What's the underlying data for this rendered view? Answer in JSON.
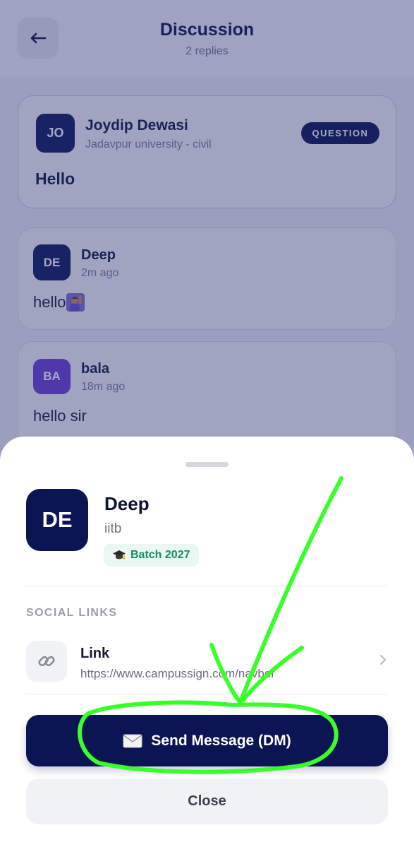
{
  "header": {
    "title": "Discussion",
    "subtitle": "2 replies",
    "back_icon": "arrow-left-icon"
  },
  "question": {
    "avatar_initials": "JO",
    "author": "Joydip Dewasi",
    "meta": "Jadavpur university - civil",
    "badge": "QUESTION",
    "text": "Hello"
  },
  "replies": [
    {
      "avatar_initials": "DE",
      "author": "Deep",
      "time": "2m ago",
      "text": "hello",
      "emoji_icon": "raising-hand-person-icon",
      "avatar_color": "#0b1b5e"
    },
    {
      "avatar_initials": "BA",
      "author": "bala",
      "time": "18m ago",
      "text": "hello sir",
      "avatar_color": "#6a3ed6"
    }
  ],
  "profile_sheet": {
    "avatar_initials": "DE",
    "name": "Deep",
    "school": "iitb",
    "batch": "Batch 2027",
    "batch_icon": "graduation-cap-icon",
    "section_label": "SOCIAL LINKS",
    "link": {
      "title": "Link",
      "url": "https://www.campussign.com/navber",
      "icon": "chain-link-icon"
    },
    "dm_button": "Send Message (DM)",
    "dm_icon": "envelope-icon",
    "close_button": "Close"
  },
  "colors": {
    "primary": "#0b1553",
    "badge_green": "#14915f",
    "annotation": "#39ff2a"
  }
}
